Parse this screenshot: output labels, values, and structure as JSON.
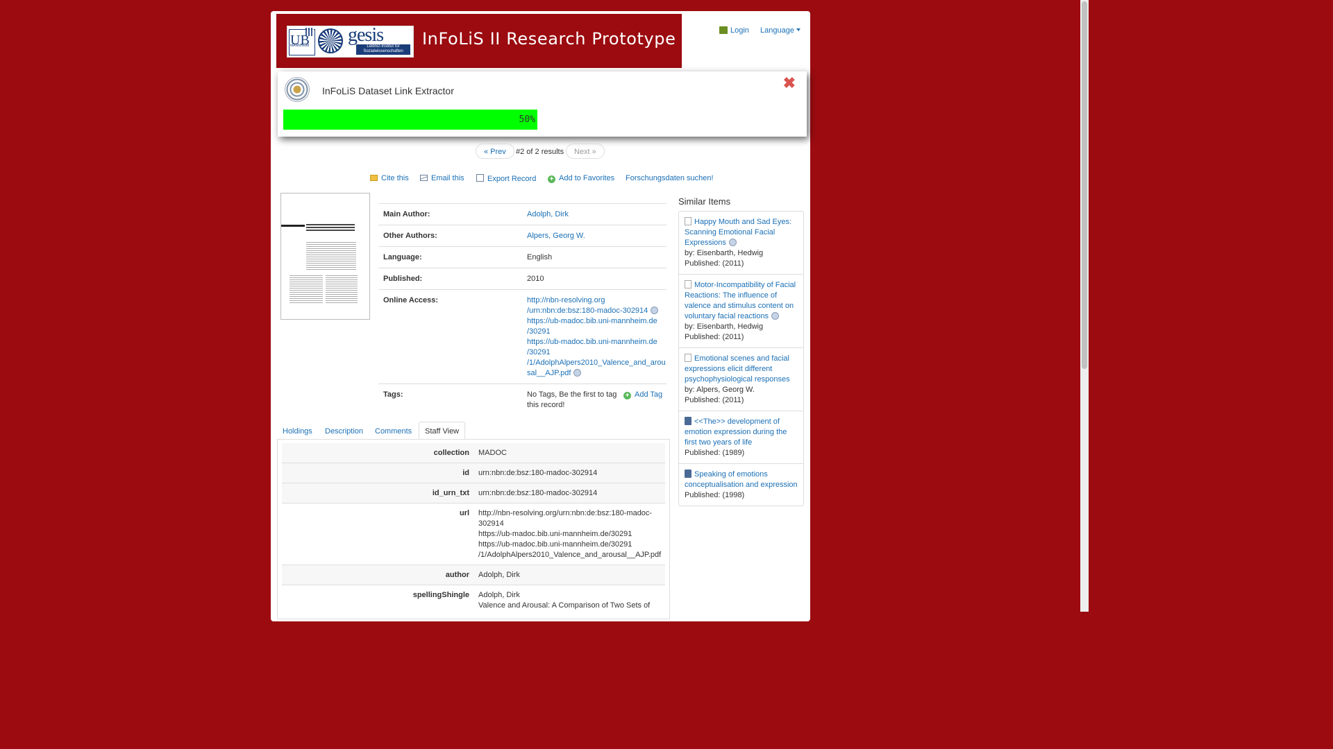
{
  "header": {
    "title": "InFoLiS II Research Prototype",
    "logos": {
      "ub": "UB",
      "ub_sub": "MANNHEIM",
      "gesis": "gesis",
      "gesis_sub": "Leibniz-Institut für Sozialwissenschaften"
    },
    "login": "Login",
    "language": "Language"
  },
  "overlay": {
    "title": "InFoLiS Dataset Link Extractor",
    "close": "✖",
    "progress_value": 0.5,
    "progress_label": "50%",
    "progress_color": "#00ff00"
  },
  "pager": {
    "prev": "« Prev",
    "status": "#2 of 2 results",
    "next": "Next »"
  },
  "toolbar": {
    "cite": "Cite this",
    "email": "Email this",
    "export": "Export Record",
    "favorites": "Add to Favorites",
    "research": "Forschungsdaten suchen!"
  },
  "details": {
    "main_author_label": "Main Author:",
    "main_author": "Adolph, Dirk",
    "other_authors_label": "Other Authors:",
    "other_authors": "Alpers, Georg W.",
    "language_label": "Language:",
    "language": "English",
    "published_label": "Published:",
    "published": "2010",
    "online_access_label": "Online Access:",
    "links": [
      "http://nbn-resolving.org/urn:nbn:de:bsz:180-madoc-302914",
      "https://ub-madoc.bib.uni-mannheim.de/30291",
      "https://ub-madoc.bib.uni-mannheim.de/30291/1/AdolphAlpers2010_Valence_and_arousal__AJP.pdf"
    ],
    "links_display": [
      [
        "http://nbn-resolving.org",
        "/urn:nbn:de:bsz:180-madoc-302914"
      ],
      [
        "https://ub-madoc.bib.uni-mannheim.de",
        "/30291"
      ],
      [
        "https://ub-madoc.bib.uni-mannheim.de",
        "/30291",
        "/1/AdolphAlpers2010_Valence_and_arou",
        "sal__AJP.pdf"
      ]
    ],
    "tags_label": "Tags:",
    "tags_text": "No Tags, Be the first to tag this record!",
    "add_tag": "Add Tag"
  },
  "similar": {
    "title": "Similar Items",
    "items": [
      {
        "title": "Happy Mouth and Sad Eyes: Scanning Emotional Facial Expressions",
        "by": "by: Eisenbarth, Hedwig",
        "published": "Published: (2011)",
        "icon": "file-icon",
        "ext": true
      },
      {
        "title": "Motor-Incompatibility of Facial Reactions: The influence of valence and stimulus content on voluntary facial reactions",
        "by": "by: Eisenbarth, Hedwig",
        "published": "Published: (2011)",
        "icon": "file-icon",
        "ext": true
      },
      {
        "title": "Emotional scenes and facial expressions elicit different psychophysiological responses",
        "by": "by: Alpers, Georg W.",
        "published": "Published: (2011)",
        "icon": "file-icon",
        "ext": false
      },
      {
        "title": "<<The>> development of emotion expression during the first two years of life",
        "by": "",
        "published": "Published: (1989)",
        "icon": "book-icon",
        "ext": false
      },
      {
        "title": "Speaking of emotions conceptualisation and expression",
        "by": "",
        "published": "Published: (1998)",
        "icon": "book-icon",
        "ext": false
      }
    ]
  },
  "tabs": [
    "Holdings",
    "Description",
    "Comments",
    "Staff View"
  ],
  "active_tab": "Staff View",
  "staff": [
    {
      "key": "collection",
      "lines": [
        "MADOC"
      ]
    },
    {
      "key": "id",
      "lines": [
        "urn:nbn:de:bsz:180-madoc-302914"
      ]
    },
    {
      "key": "id_urn_txt",
      "lines": [
        "urn:nbn:de:bsz:180-madoc-302914"
      ]
    },
    {
      "key": "url",
      "lines": [
        "http://nbn-resolving.org/urn:nbn:de:bsz:180-madoc-",
        "302914",
        "https://ub-madoc.bib.uni-mannheim.de/30291",
        "https://ub-madoc.bib.uni-mannheim.de/30291",
        "/1/AdolphAlpers2010_Valence_and_arousal__AJP.pdf"
      ]
    },
    {
      "key": "author",
      "lines": [
        "Adolph, Dirk"
      ]
    },
    {
      "key": "spellingShingle",
      "lines": [
        "Adolph, Dirk",
        "Valence and Arousal: A Comparison of Two Sets of"
      ]
    }
  ],
  "colors": {
    "background": "#9b0b10",
    "link": "#1a6fb5",
    "accent": "#9b0b10"
  }
}
